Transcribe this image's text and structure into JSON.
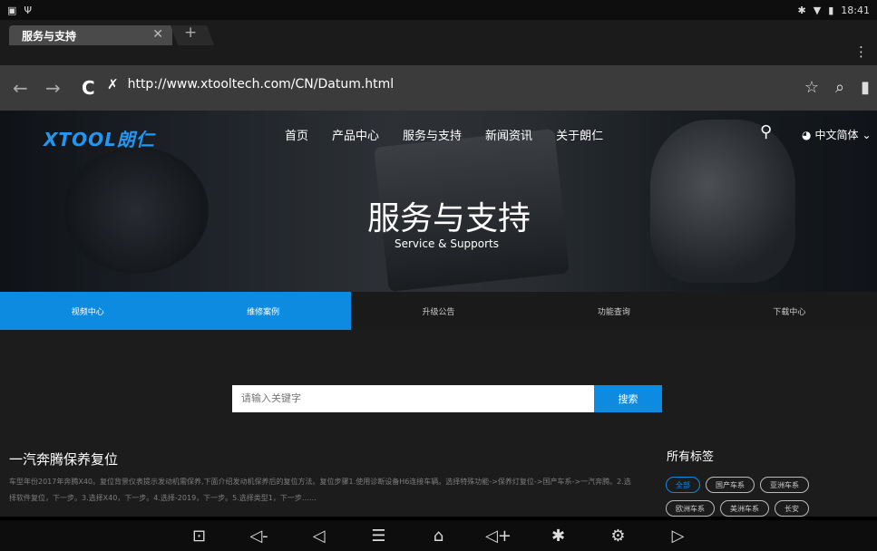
{
  "status_bar": {
    "left_icons": [
      "image-icon",
      "usb-icon"
    ],
    "right_icons": [
      "bluetooth-icon",
      "wifi-icon",
      "battery-icon"
    ],
    "time": "18:41"
  },
  "browser": {
    "tab_title": "服务与支持",
    "url": "http://www.xtooltech.com/CN/Datum.html"
  },
  "site": {
    "logo": "XTOOL朗仁",
    "nav": [
      "首页",
      "产品中心",
      "服务与支持",
      "新闻资讯",
      "关于朗仁"
    ],
    "language": "中文简体"
  },
  "hero": {
    "title": "服务与支持",
    "subtitle": "Service & Supports"
  },
  "categories": [
    {
      "label": "视频中心",
      "active": true
    },
    {
      "label": "维修案例",
      "active": true
    },
    {
      "label": "升级公告",
      "active": false
    },
    {
      "label": "功能查询",
      "active": false
    },
    {
      "label": "下载中心",
      "active": false
    }
  ],
  "search": {
    "placeholder": "请输入关键字",
    "button": "搜索"
  },
  "article": {
    "title": "一汽奔腾保养复位",
    "body": "车型年份2017年奔腾X40。复位背景仪表提示发动机需保养,下面介绍发动机保养后的复位方法。复位步骤1.使用诊断设备H6连接车辆。选择特殊功能->保养灯复位->国产车系->一汽奔腾。2.选择软件复位，下一步。3.选择X40，下一步。4.选择-2019，下一步。5.选择类型1，下一步……"
  },
  "tags": {
    "title": "所有标签",
    "items": [
      "全部",
      "国产车系",
      "亚洲车系",
      "欧洲车系",
      "美洲车系",
      "长安"
    ]
  },
  "android_nav_icons": [
    "screenshot-icon",
    "volume-down-icon",
    "back-icon",
    "menu-icon",
    "home-icon",
    "volume-up-icon",
    "bluetooth-icon",
    "diagnostic-icon",
    "screen-record-icon"
  ],
  "colors": {
    "accent": "#0c8be0"
  }
}
